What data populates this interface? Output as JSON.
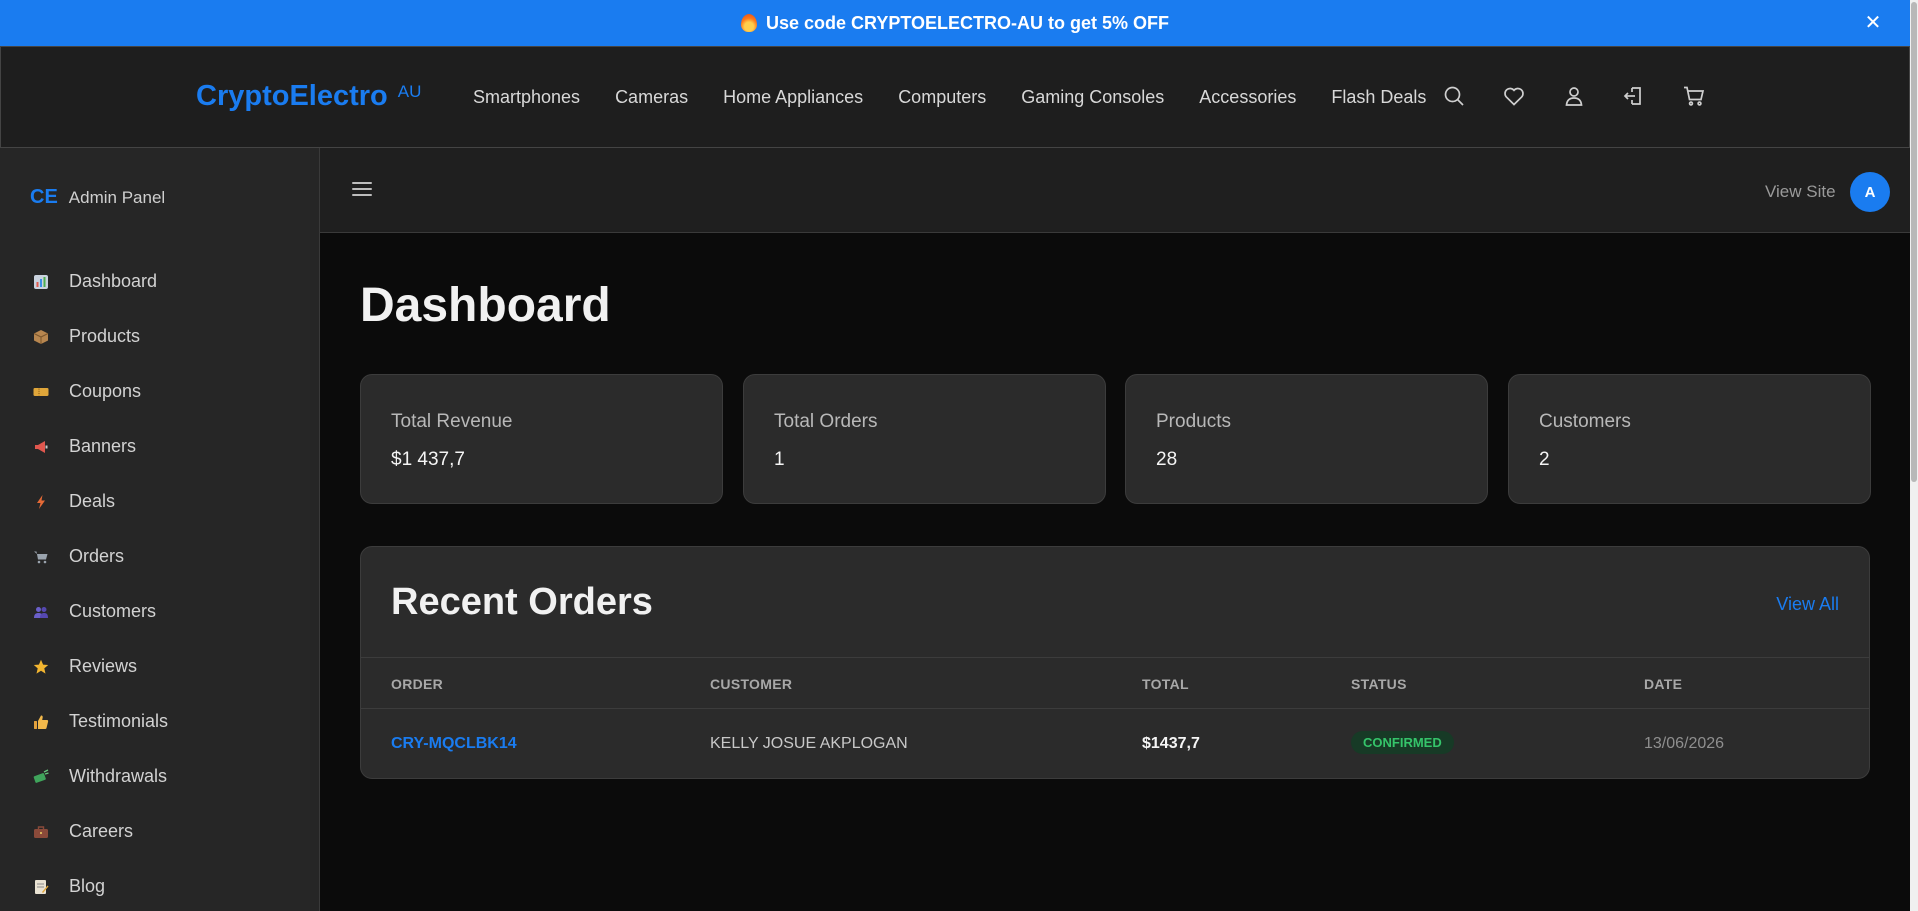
{
  "promo": {
    "text": "Use code CRYPTOELECTRO-AU to get 5% OFF",
    "close_icon": "close-icon",
    "close_glyph": "✕"
  },
  "header": {
    "brand": "CryptoElectro",
    "region": "AU",
    "nav": [
      "Smartphones",
      "Cameras",
      "Home Appliances",
      "Computers",
      "Gaming Consoles",
      "Accessories",
      "Flash Deals"
    ],
    "icons": [
      "search-icon",
      "heart-icon",
      "user-icon",
      "logout-icon",
      "cart-icon"
    ]
  },
  "sidebar": {
    "logo": "CE",
    "title": "Admin Panel",
    "items": [
      {
        "label": "Dashboard",
        "icon": "chart-icon"
      },
      {
        "label": "Products",
        "icon": "box-icon"
      },
      {
        "label": "Coupons",
        "icon": "ticket-icon"
      },
      {
        "label": "Banners",
        "icon": "megaphone-icon"
      },
      {
        "label": "Deals",
        "icon": "lightning-icon"
      },
      {
        "label": "Orders",
        "icon": "cart-icon"
      },
      {
        "label": "Customers",
        "icon": "users-icon"
      },
      {
        "label": "Reviews",
        "icon": "star-icon"
      },
      {
        "label": "Testimonials",
        "icon": "thumbs-up-icon"
      },
      {
        "label": "Withdrawals",
        "icon": "money-icon"
      },
      {
        "label": "Careers",
        "icon": "briefcase-icon"
      },
      {
        "label": "Blog",
        "icon": "memo-icon"
      }
    ]
  },
  "topbar": {
    "view_site": "View Site",
    "avatar": "A"
  },
  "main": {
    "title": "Dashboard",
    "stats": [
      {
        "label": "Total Revenue",
        "value": "$1 437,7"
      },
      {
        "label": "Total Orders",
        "value": "1"
      },
      {
        "label": "Products",
        "value": "28"
      },
      {
        "label": "Customers",
        "value": "2"
      }
    ],
    "recent_orders": {
      "title": "Recent Orders",
      "view_all": "View All",
      "columns": [
        "ORDER",
        "CUSTOMER",
        "TOTAL",
        "STATUS",
        "DATE"
      ],
      "rows": [
        {
          "order": "CRY-MQCLBK14",
          "customer": "KELLY JOSUE AKPLOGAN",
          "total": "$1437,7",
          "status": "CONFIRMED",
          "date": "13/06/2026"
        }
      ]
    }
  },
  "colors": {
    "accent": "#1a7cf0",
    "status_confirmed": "#35c46a"
  }
}
